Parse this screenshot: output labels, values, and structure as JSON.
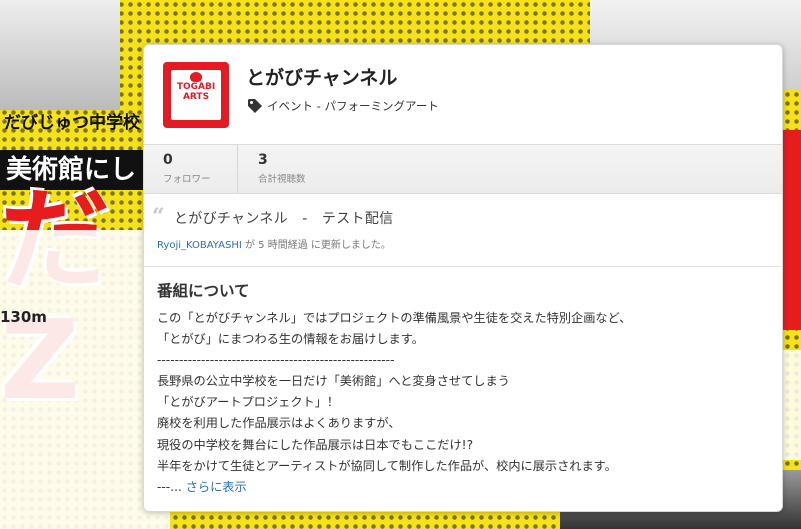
{
  "background": {
    "band_top": "だびじゅつ中学校",
    "band_main": "美術館にし",
    "big_letters": "だZ",
    "meter": "130m"
  },
  "channel": {
    "name": "とがびチャンネル",
    "logo_text": "TOGABI ARTS",
    "category": "イベント - パフォーミングアート"
  },
  "stats": [
    {
      "value": "0",
      "label": "フォロワー"
    },
    {
      "value": "3",
      "label": "合計視聴数"
    }
  ],
  "latest": {
    "title": "とがびチャンネル　-　テスト配信",
    "author": "Ryoji_KOBAYASHI",
    "meta_suffix": " が 5 時間経過 に更新しました。"
  },
  "about": {
    "title": "番組について",
    "lines": [
      "この「とがびチャンネル」ではプロジェクトの準備風景や生徒を交えた特別企画など、",
      "「とがび」にまつわる生の情報をお届けします。",
      "------------------------------------------------------",
      "長野県の公立中学校を一日だけ「美術館」へと変身させてしまう",
      "「とがびアートプロジェクト」！",
      "廃校を利用した作品展示はよくありますが、",
      "現役の中学校を舞台にした作品展示は日本でもここだけ!?",
      "半年をかけて生徒とアーティストが協同して制作した作品が、校内に展示されます。"
    ],
    "ellipsis": "---... ",
    "more_link": "さらに表示"
  },
  "colors": {
    "link": "#2a6fb3",
    "logo_red": "#e31b22",
    "background_yellow": "#f5e21a"
  },
  "icons": {
    "category": "tag-icon",
    "quote": "quote-icon"
  }
}
